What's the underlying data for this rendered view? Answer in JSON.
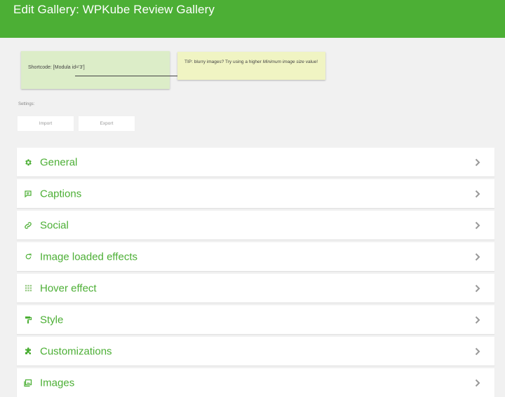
{
  "header": {
    "title": "Edit Gallery: WPKube Review Gallery"
  },
  "shortcode_note": {
    "text": "Shortcode: [Modula id='3']"
  },
  "tip_note": {
    "prefix": "TIP: blurry images? Try using a higher ",
    "emphasis": "Minimum image size",
    "suffix": " value!"
  },
  "settings": {
    "label": "Settings:",
    "import_label": "Import",
    "export_label": "Export"
  },
  "accent_color": "#4caf35",
  "sections": [
    {
      "label": "General",
      "icon": "gear-icon"
    },
    {
      "label": "Captions",
      "icon": "comment-icon"
    },
    {
      "label": "Social",
      "icon": "link-icon"
    },
    {
      "label": "Image loaded effects",
      "icon": "refresh-icon"
    },
    {
      "label": "Hover effect",
      "icon": "grid-icon"
    },
    {
      "label": "Style",
      "icon": "paint-roller-icon"
    },
    {
      "label": "Customizations",
      "icon": "puzzle-icon"
    },
    {
      "label": "Images",
      "icon": "image-icon"
    }
  ]
}
